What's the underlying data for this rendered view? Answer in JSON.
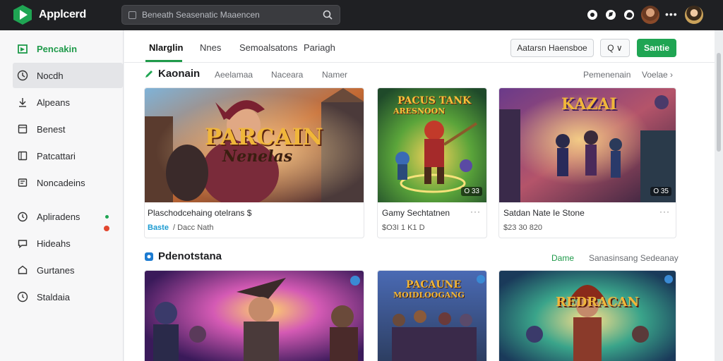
{
  "app": {
    "title": "Applcerd"
  },
  "search": {
    "placeholder": "Beneath Seasenatic Maaencen"
  },
  "sidebar": {
    "items": [
      {
        "label": "Pencakin",
        "icon": "store-icon"
      },
      {
        "label": "Nocdh",
        "icon": "clock-icon"
      },
      {
        "label": "Alpeans",
        "icon": "download-icon"
      },
      {
        "label": "Benest",
        "icon": "bookmark-icon"
      },
      {
        "label": "Patcattari",
        "icon": "library-icon"
      },
      {
        "label": "Noncadeins",
        "icon": "notification-icon"
      },
      {
        "label": "Apliradens",
        "icon": "timer-icon"
      },
      {
        "label": "Hideahs",
        "icon": "chat-icon"
      },
      {
        "label": "Gurtanes",
        "icon": "home-icon"
      },
      {
        "label": "Staldaia",
        "icon": "settings-icon"
      }
    ]
  },
  "tabs": [
    {
      "label": "Nlarglin"
    },
    {
      "label": "Nnes"
    },
    {
      "label": "Semoalsatons"
    },
    {
      "label": "Pariagh"
    }
  ],
  "header_actions": {
    "filter_label": "Aatarsn Haensboe",
    "sort_label": "Q ∨",
    "primary_label": "Santie"
  },
  "section1": {
    "title": "Kaonain",
    "subtabs": [
      "Aeelamaa",
      "Naceara",
      "Namer"
    ],
    "right_links": [
      "Pemenenain",
      "Voelae ›"
    ],
    "cards": [
      {
        "title": "Plaschodcehaing otelrans $",
        "meta_accent": "Baste",
        "meta": "/ Dacc Nath",
        "art_text_1": "PARCAIN",
        "art_text_2": "Nenelas"
      },
      {
        "title": "Gamy Sechtatnen",
        "meta": "$O3I 1 K1 D",
        "badge": "O 33",
        "art_text_1": "PACUS TANK",
        "art_text_2": "ARESNOON"
      },
      {
        "title": "Satdan Nate Ie Stone",
        "meta": "$23 30 820",
        "badge": "O 35",
        "art_text_1": "KAZAI",
        "art_text_2": ""
      }
    ]
  },
  "section2": {
    "title": "Pdenotstana",
    "right_links": [
      "Dame",
      "Sanasinsang Sedeanay"
    ],
    "cards": [
      {
        "art_text_1": ""
      },
      {
        "art_text_1": "PACAUNE",
        "art_text_2": "MOIDLOOGANG"
      },
      {
        "art_text_1": "REDRACAN"
      }
    ]
  },
  "colors": {
    "accent": "#1fa553",
    "topbar": "#1f2023",
    "link_blue": "#1c9bd1"
  }
}
